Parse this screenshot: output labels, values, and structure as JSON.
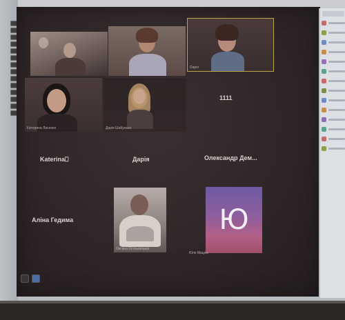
{
  "meeting": {
    "tiles": [
      {
        "name": "",
        "caption": ""
      },
      {
        "name": "",
        "caption": ""
      },
      {
        "name": "",
        "caption": "Dарія"
      },
      {
        "name": "",
        "caption": "Катерина Лисенко"
      },
      {
        "name": "",
        "caption": "Дарія Шабунько"
      },
      {
        "name": "1111",
        "caption": ""
      },
      {
        "name": "Katerina⎕",
        "caption": ""
      },
      {
        "name": "Дарія",
        "caption": ""
      },
      {
        "name": "Олександр  Дем...",
        "caption": ""
      },
      {
        "name": "Аліна Гедима",
        "caption": ""
      },
      {
        "name": "",
        "caption": "Оксана Огольвецька"
      },
      {
        "name": "",
        "caption": "Юля Мацюк"
      }
    ],
    "avatar_letter": "Ю"
  },
  "colors": {
    "screen_bg": "#2b2325",
    "active_speaker_border": "#b8a84a",
    "avatar_gradient_top": "#6e5aa3",
    "avatar_gradient_bottom": "#a14f69"
  },
  "icons": [
    "speaker-grille-icon",
    "taskbar-app-icon",
    "chat-panel-avatar-icon"
  ]
}
